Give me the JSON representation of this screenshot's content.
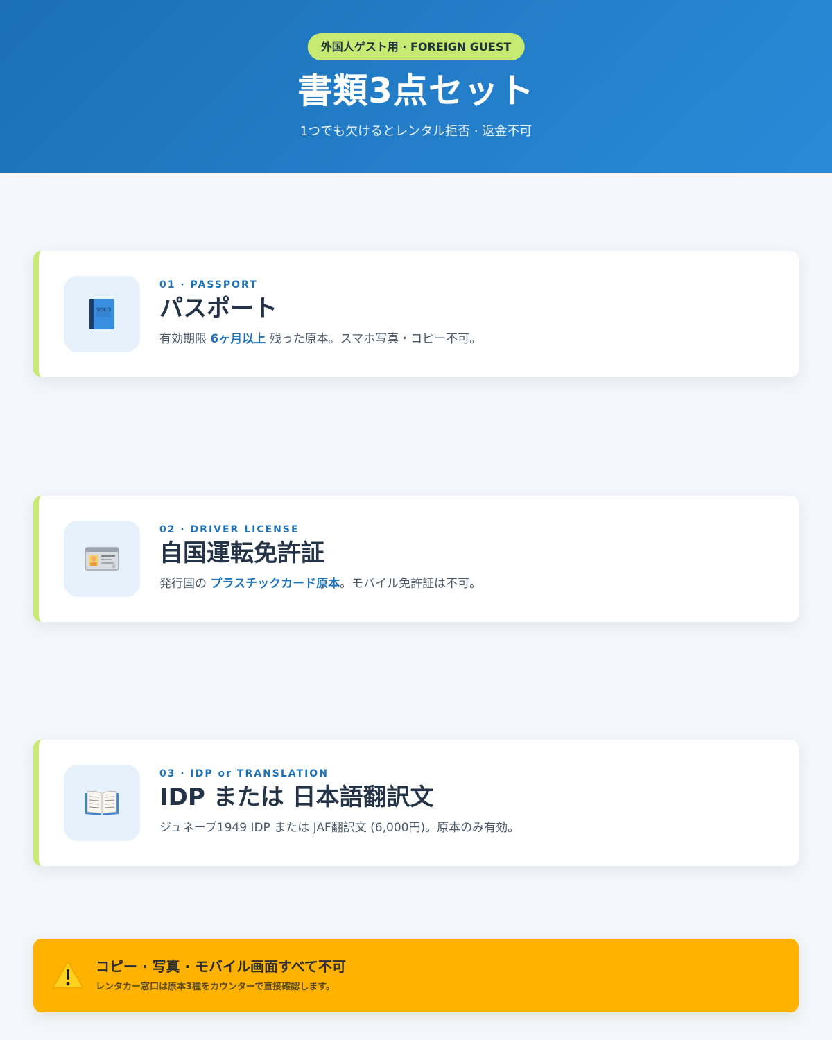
{
  "header": {
    "badge": "外国人ゲスト用 · FOREIGN GUEST",
    "title": "書類3点セット",
    "subtitle": "1つでも欠けるとレンタル拒否 · 返金不可"
  },
  "accent_colors": {
    "header_blue": "#1c6fb6",
    "accent_green": "#c6ea72",
    "highlight_blue": "#1d72b8",
    "warning_amber": "#ffb300"
  },
  "documents": [
    {
      "icon": "passport-book-icon",
      "kicker": "01 · PASSPORT",
      "title": "パスポート",
      "desc_pre": "有効期限 ",
      "desc_highlight": "6ヶ月以上",
      "desc_post": " 残った原本。スマホ写真・コピー不可。",
      "icon_text": "VOL 3"
    },
    {
      "icon": "id-card-icon",
      "kicker": "02 · DRIVER LICENSE",
      "title": "自国運転免許証",
      "desc_pre": "発行国の ",
      "desc_highlight": "プラスチックカード原本",
      "desc_post": "。モバイル免許証は不可。"
    },
    {
      "icon": "open-book-icon",
      "kicker": "03 · IDP or TRANSLATION",
      "title": "IDP または 日本語翻訳文",
      "desc_pre": "ジュネーブ1949 IDP または JAF翻訳文 (6,000円)。原本のみ有効。",
      "desc_highlight": "",
      "desc_post": ""
    }
  ],
  "warning": {
    "icon": "warning-icon",
    "title": "コピー · 写真 · モバイル画面すべて不可",
    "subtitle": "レンタカー窓口は原本3種をカウンターで直接確認します。"
  }
}
